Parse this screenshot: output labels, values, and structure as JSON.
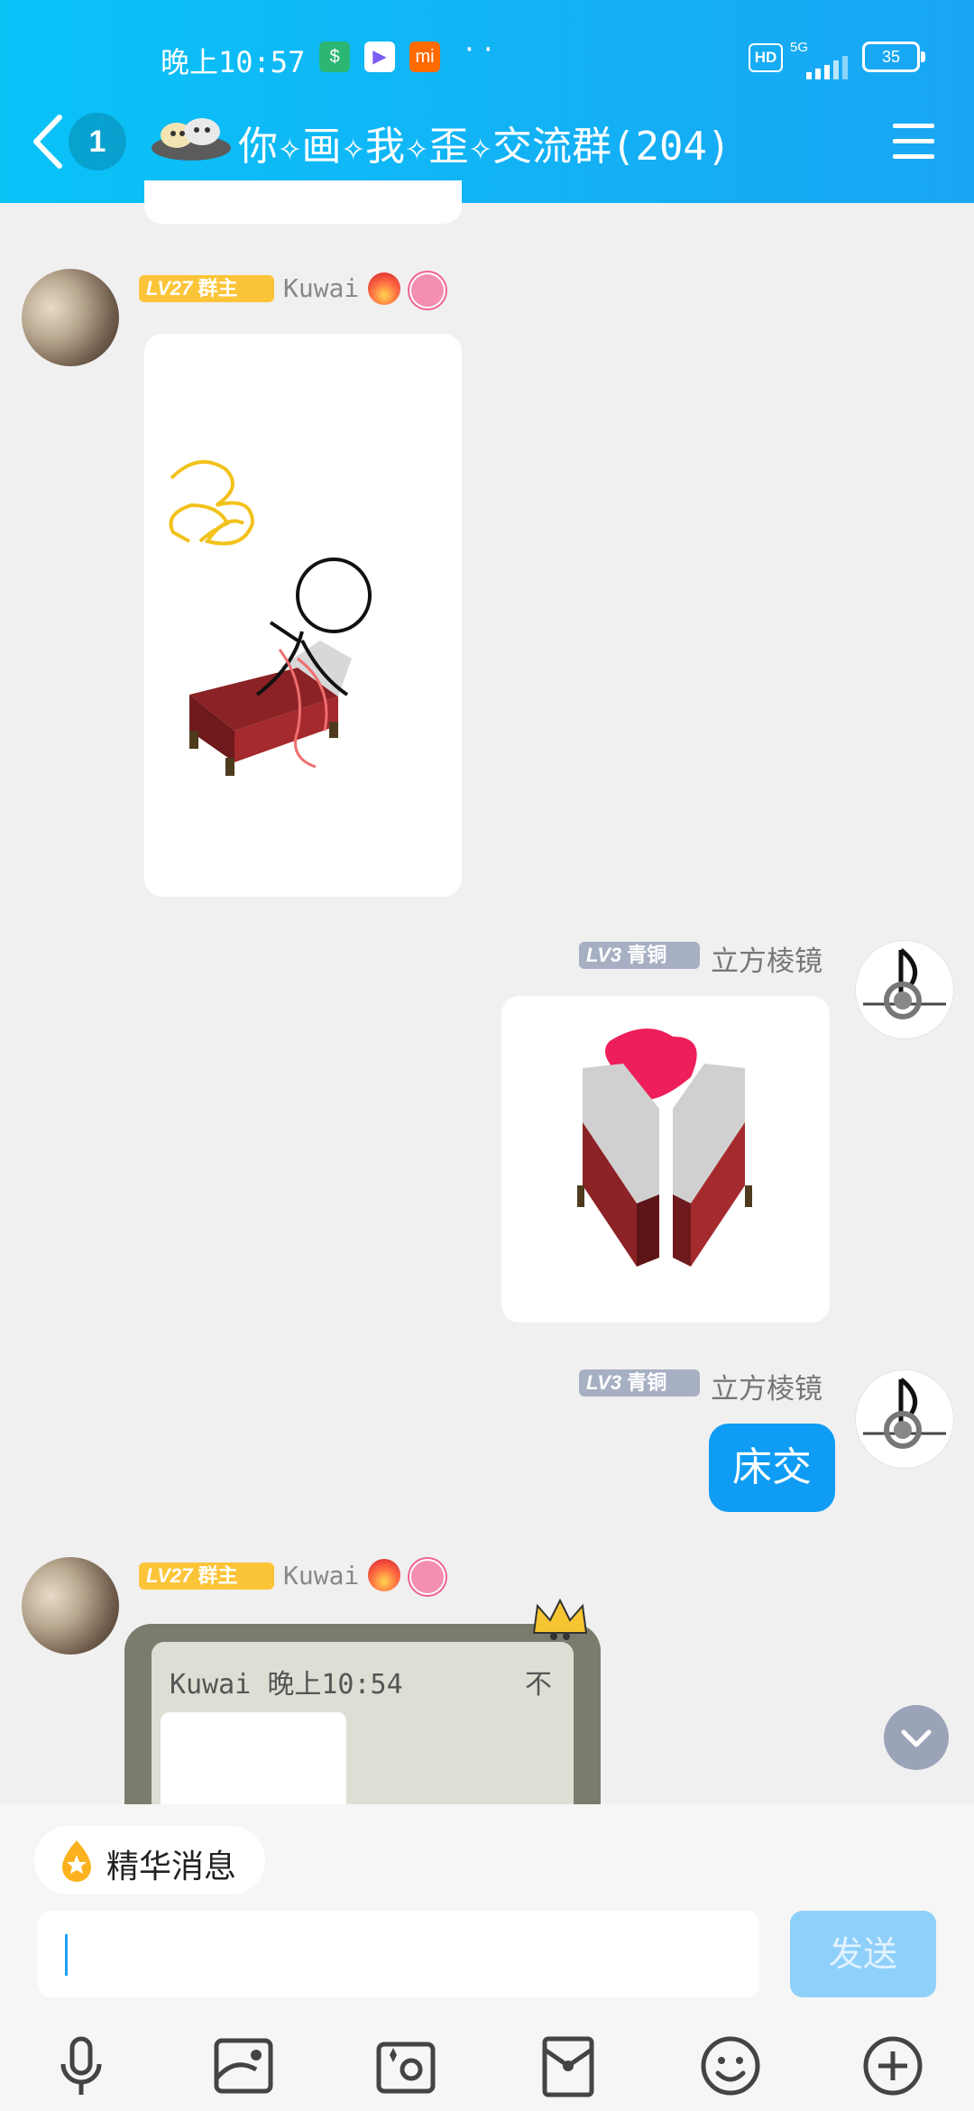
{
  "status_bar": {
    "time": "晚上10:57",
    "dots": "··",
    "hd": "HD",
    "network": "5G",
    "battery": "35"
  },
  "header": {
    "unread_count": "1",
    "group_title": "你✧画✧我✧歪✧交流群(204)"
  },
  "messages": [
    {
      "side": "left",
      "level": "LV27",
      "role": "群主",
      "sender": "Kuwai",
      "content_type": "image",
      "image_desc": "stick figure on red bed"
    },
    {
      "side": "right",
      "level": "LV3",
      "role": "青铜",
      "sender": "立方棱镜",
      "content_type": "image",
      "image_desc": "two beds with pink heart"
    },
    {
      "side": "right",
      "level": "LV3",
      "role": "青铜",
      "sender": "立方棱镜",
      "content_type": "text",
      "text": "床交"
    },
    {
      "side": "left",
      "level": "LV27",
      "role": "群主",
      "sender": "Kuwai",
      "content_type": "quote",
      "quote_header": "Kuwai 晚上10:54",
      "quote_pin": "不"
    }
  ],
  "composer": {
    "essence_label": "精华消息",
    "input_value": "",
    "send_label": "发送"
  },
  "toolbar": [
    "microphone-icon",
    "image-icon",
    "camera-icon",
    "red-packet-icon",
    "emoji-icon",
    "plus-icon"
  ],
  "colors": {
    "header": "#12b2f5",
    "bubble": "#0f9cf4",
    "send_disabled": "#8fd0fb",
    "badge_owner": "#fcc438",
    "badge_member": "#a7afc3"
  }
}
